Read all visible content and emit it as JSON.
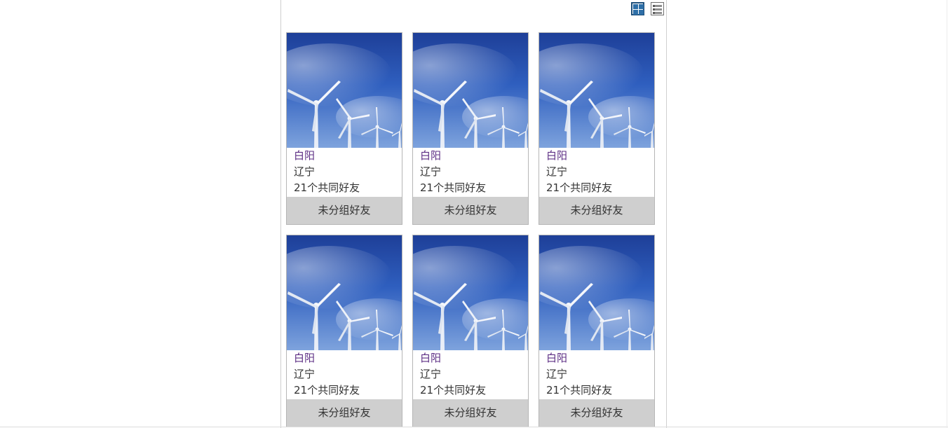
{
  "toolbar": {
    "grid_view_icon": "grid-view-icon",
    "list_view_icon": "list-view-icon"
  },
  "friends": [
    {
      "name": "白阳",
      "region": "辽宁",
      "mutual": "21个共同好友",
      "group_label": "未分组好友"
    },
    {
      "name": "白阳",
      "region": "辽宁",
      "mutual": "21个共同好友",
      "group_label": "未分组好友"
    },
    {
      "name": "白阳",
      "region": "辽宁",
      "mutual": "21个共同好友",
      "group_label": "未分组好友"
    },
    {
      "name": "白阳",
      "region": "辽宁",
      "mutual": "21个共同好友",
      "group_label": "未分组好友"
    },
    {
      "name": "白阳",
      "region": "辽宁",
      "mutual": "21个共同好友",
      "group_label": "未分组好友"
    },
    {
      "name": "白阳",
      "region": "辽宁",
      "mutual": "21个共同好友",
      "group_label": "未分组好友"
    }
  ],
  "colors": {
    "name_link": "#5b2c83",
    "group_button_bg": "#cfcfcf",
    "sky_top": "#1c3f9a",
    "sky_bottom": "#8fb2e6"
  }
}
